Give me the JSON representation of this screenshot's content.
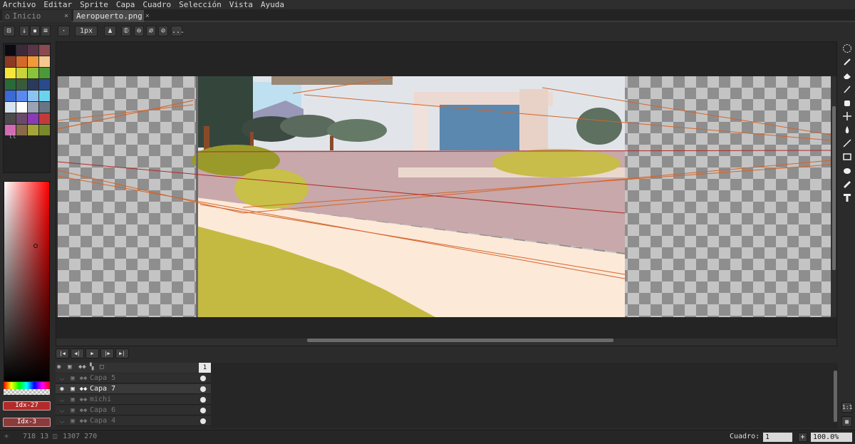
{
  "menu": [
    "Archivo",
    "Editar",
    "Sprite",
    "Capa",
    "Cuadro",
    "Selección",
    "Vista",
    "Ayuda"
  ],
  "tabs": {
    "home": "Inicio",
    "file": "Aeropuerto.png",
    "close": "×"
  },
  "toolbar": {
    "brush_size": "1px",
    "more": "..."
  },
  "palette": {
    "colors": [
      "#0a0a12",
      "#3c2a3a",
      "#5a3548",
      "#8a4a50",
      "#8c3a24",
      "#d46a2a",
      "#f09a3a",
      "#f5c890",
      "#f5e63a",
      "#c8d43a",
      "#8ac43a",
      "#4a9a3a",
      "#2a6a3a",
      "#3a5a3a",
      "#2a3a5a",
      "#2a4a8a",
      "#3a6ad4",
      "#5a8af0",
      "#8ac4f0",
      "#6ad4f0",
      "#d4e4f0",
      "#ffffff",
      "#9aa4b4",
      "#6a7484",
      "#4a4a4a",
      "#6a4a6a",
      "#8a3ab4",
      "#c43a3a",
      "#d46ab4",
      "#8a6a4a",
      "#a4a43a",
      "#7a8a2a"
    ],
    "handle": "ll"
  },
  "picker": {
    "fg_index": "Idx-27",
    "bg_index": "Idx-3"
  },
  "accent": {
    "orange_guide": "#d4652a",
    "red_guide": "#b02a2a"
  },
  "timeline": {
    "frame_number": "1",
    "layers": [
      {
        "name": "Capa 5",
        "active": false
      },
      {
        "name": "Capa 7",
        "active": true
      },
      {
        "name": "michi",
        "active": false
      },
      {
        "name": "Capa 6",
        "active": false
      },
      {
        "name": "Capa 4",
        "active": false
      }
    ]
  },
  "status": {
    "cursor_pos": "718 13",
    "selection_size": "1307 270",
    "frame_label": "Cuadro:",
    "frame_value": "1",
    "zoom": "100.0%"
  },
  "side_buttons": {
    "one_to_one": "1:1",
    "props": "▦"
  }
}
